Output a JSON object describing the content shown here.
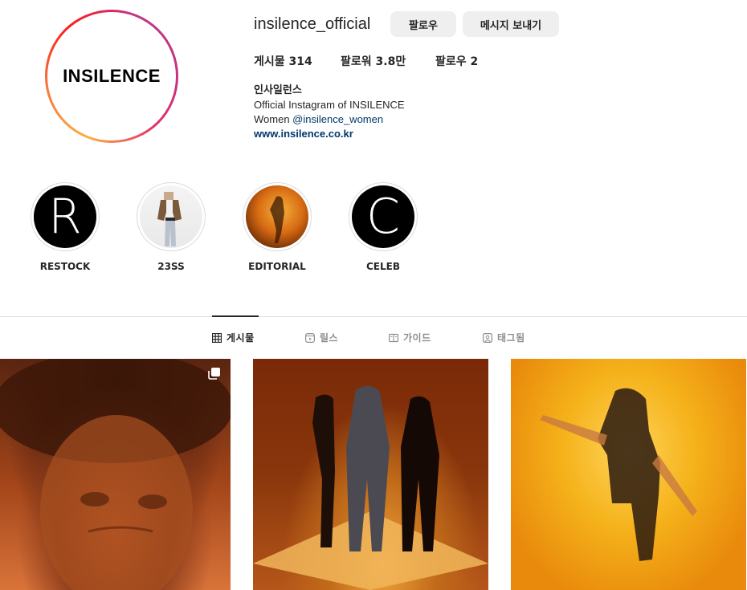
{
  "profile": {
    "avatar_text": "INSILENCE",
    "username": "insilence_official",
    "follow_label": "팔로우",
    "message_label": "메시지 보내기"
  },
  "stats": {
    "posts": "게시물 314",
    "followers": "팔로워 3.8만",
    "following": "팔로우 2"
  },
  "bio": {
    "name": "인사일런스",
    "line1": "Official Instagram of INSILENCE",
    "line2_prefix": "Women ",
    "line2_mention": "@insilence_women",
    "url": "www.insilence.co.kr"
  },
  "highlights": [
    {
      "label": "RESTOCK",
      "glyph": "R"
    },
    {
      "label": "23SS"
    },
    {
      "label": "EDITORIAL"
    },
    {
      "label": "CELEB",
      "glyph": "C"
    }
  ],
  "tabs": [
    {
      "label": "게시물",
      "icon": "grid-icon"
    },
    {
      "label": "릴스",
      "icon": "reels-icon"
    },
    {
      "label": "가이드",
      "icon": "guide-icon"
    },
    {
      "label": "태그됨",
      "icon": "tagged-icon"
    }
  ],
  "colors": {
    "accent_link": "#00376b",
    "button_bg": "#efefef",
    "divider": "#dbdbdb"
  }
}
